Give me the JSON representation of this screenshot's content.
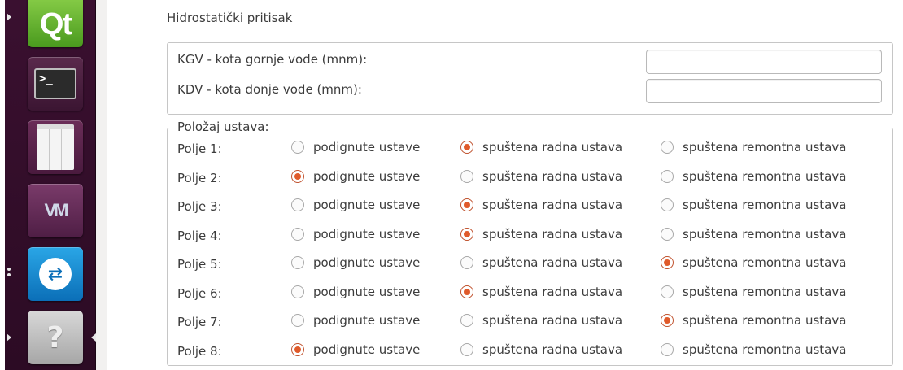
{
  "launcher": {
    "items": [
      {
        "name": "qt-creator",
        "glyph": "Qt"
      },
      {
        "name": "terminal",
        "glyph": ">_"
      },
      {
        "name": "files",
        "glyph": ""
      },
      {
        "name": "vmware",
        "glyph": "VM"
      },
      {
        "name": "teamviewer",
        "glyph": "⇄"
      },
      {
        "name": "help",
        "glyph": "?"
      }
    ]
  },
  "page": {
    "title": "Hidrostatički pritisak"
  },
  "levels": {
    "kgv_label": "KGV - kota gornje vode (mnm):",
    "kgv_value": "",
    "kdv_label": "KDV - kota donje vode (mnm):",
    "kdv_value": ""
  },
  "gates": {
    "legend": "Položaj ustava:",
    "options": [
      "podignute ustave",
      "spuštena radna ustava",
      "spuštena remontna ustava"
    ],
    "rows": [
      {
        "label": "Polje 1:",
        "selected": 1
      },
      {
        "label": "Polje 2:",
        "selected": 0
      },
      {
        "label": "Polje 3:",
        "selected": 1
      },
      {
        "label": "Polje 4:",
        "selected": 1
      },
      {
        "label": "Polje 5:",
        "selected": 2
      },
      {
        "label": "Polje 6:",
        "selected": 1
      },
      {
        "label": "Polje 7:",
        "selected": 2
      },
      {
        "label": "Polje 8:",
        "selected": 0
      }
    ]
  },
  "colors": {
    "launcher_bg": "#3a1030",
    "radio_accent": "#e05a2a"
  }
}
